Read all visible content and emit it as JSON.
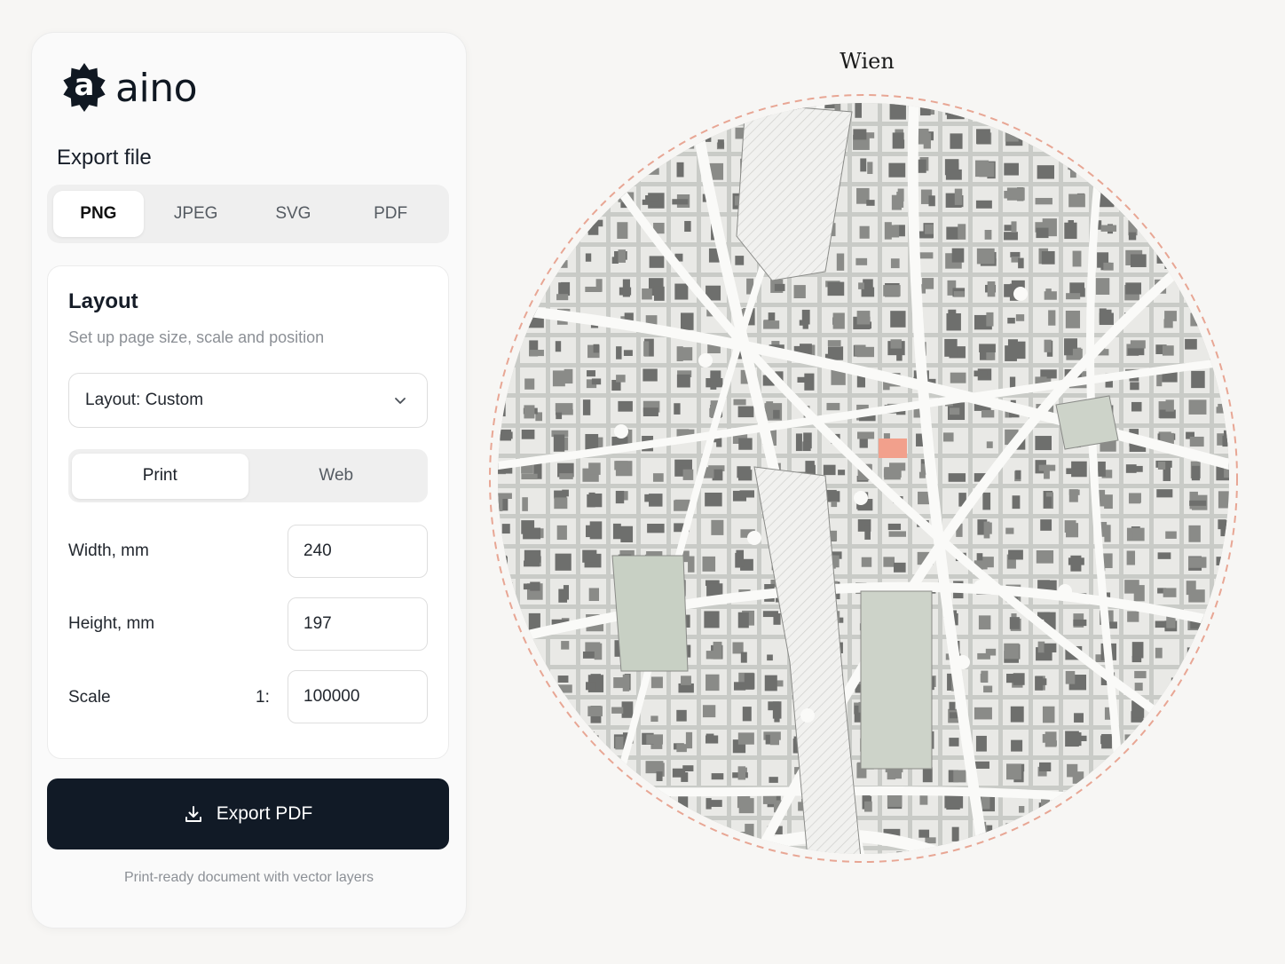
{
  "brand": {
    "name": "aino",
    "mark_letter": "a"
  },
  "export": {
    "section_title": "Export file",
    "formats": [
      "PNG",
      "JPEG",
      "SVG",
      "PDF"
    ],
    "selected_format": "PNG"
  },
  "layout": {
    "title": "Layout",
    "subtitle": "Set up page size, scale and position",
    "preset": "Layout: Custom",
    "modes": [
      "Print",
      "Web"
    ],
    "selected_mode": "Print",
    "width": {
      "label": "Width, mm",
      "value": "240"
    },
    "height": {
      "label": "Height, mm",
      "value": "197"
    },
    "scale": {
      "label": "Scale",
      "prefix": "1:",
      "value": "100000"
    }
  },
  "action": {
    "label": "Export PDF",
    "note": "Print-ready document with vector layers"
  },
  "map": {
    "title": "Wien",
    "border_color": "#e8a694",
    "highlight_color": "#f2a08c"
  },
  "colors": {
    "primary_button": "#111a26",
    "accent": "#e8a694"
  }
}
